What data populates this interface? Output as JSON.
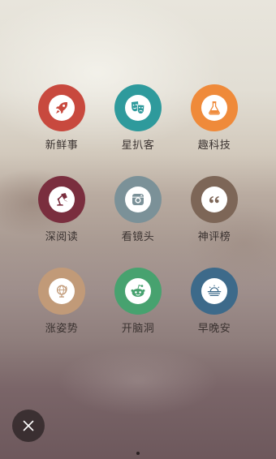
{
  "items": [
    {
      "label": "新鲜事",
      "color": "#c8493e",
      "icon": "rocket-icon"
    },
    {
      "label": "星扒客",
      "color": "#2e9a9c",
      "icon": "theater-masks-icon"
    },
    {
      "label": "趣科技",
      "color": "#ef8a3a",
      "icon": "flask-icon"
    },
    {
      "label": "深阅读",
      "color": "#7a2e3e",
      "icon": "desk-lamp-icon"
    },
    {
      "label": "看镜头",
      "color": "#7b9198",
      "icon": "camera-icon"
    },
    {
      "label": "神评榜",
      "color": "#7d6657",
      "icon": "quote-icon"
    },
    {
      "label": "涨姿势",
      "color": "#c19a78",
      "icon": "globe-icon"
    },
    {
      "label": "开脑洞",
      "color": "#47a26f",
      "icon": "alien-face-icon"
    },
    {
      "label": "早晚安",
      "color": "#3d6a8a",
      "icon": "sunrise-icon"
    }
  ],
  "close_button": {
    "icon": "close-icon"
  },
  "pagination": {
    "current": 1,
    "total": 1
  }
}
